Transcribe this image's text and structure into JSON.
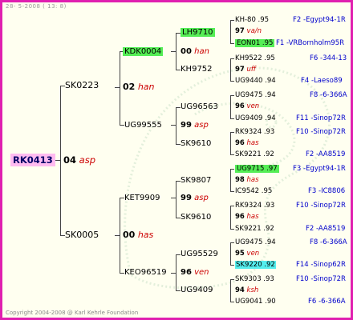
{
  "header": "28- 5-2008 ( 13: 8)",
  "footer": "Copyright 2004-2008 @ Karl Kehrle Foundation",
  "root": {
    "ring": "RK0413",
    "year": "04",
    "note": "asp"
  },
  "gen2": [
    {
      "ring": "SK0223",
      "year": "",
      "note": ""
    },
    {
      "ring": "SK0005",
      "year": "",
      "note": ""
    }
  ],
  "gen2_stats": [
    {
      "year": "02",
      "note": "han"
    },
    {
      "year": "00",
      "note": "has"
    }
  ],
  "gen3": [
    {
      "ring": "KDK0004",
      "year": "",
      "note": ""
    },
    {
      "ring": "UG99555",
      "year": "",
      "note": ""
    },
    {
      "ring": "KET9909",
      "year": "",
      "note": ""
    },
    {
      "ring": "KEO96519",
      "year": "",
      "note": ""
    }
  ],
  "gen3_stats": [
    {
      "year": "",
      "note": ""
    },
    {
      "year": "99",
      "note": "asp"
    },
    {
      "year": "99",
      "note": "asp"
    },
    {
      "year": "96",
      "note": "ven"
    }
  ],
  "gen4": [
    {
      "ring": "LH9710",
      "mid_year": "00",
      "mid_note": "han",
      "ring2": "KH9752"
    },
    {
      "ring": "UG96563",
      "mid_year": "99",
      "mid_note": "asp",
      "ring2": "SK9610"
    },
    {
      "ring": "SK9807",
      "mid_year": "99",
      "mid_note": "asp",
      "ring2": "SK9610"
    },
    {
      "ring": "UG95529",
      "mid_year": "96",
      "mid_note": "ven",
      "ring2": "UG9409"
    }
  ],
  "gen5": [
    {
      "a": "KH-80 .95",
      "mid": "97",
      "mid_note": "va/n",
      "b": "EON01 .95",
      "loc_a": "F2 -Egypt94-1R",
      "loc_b": "F1 -VRBornholm95R"
    },
    {
      "a": "KH9522 .95",
      "mid": "97",
      "mid_note": "uff",
      "b": "UG9440 .94",
      "loc_a": "F6 -344-13",
      "loc_b": "F4 -Laeso89"
    },
    {
      "a": "UG9475 .94",
      "mid": "96",
      "mid_note": "ven",
      "b": "UG9409 .94",
      "loc_a": "F8 -6-366A",
      "loc_b": "F11 -Sinop72R"
    },
    {
      "a": "RK9324 .93",
      "mid": "96",
      "mid_note": "has",
      "b": "SK9221 .92",
      "loc_a": "F10 -Sinop72R",
      "loc_b": "F2 -AA8519"
    },
    {
      "a": "UG9715 .97",
      "mid": "98",
      "mid_note": "has",
      "b": "IC9542 .95",
      "loc_a": "F3 -Egypt94-1R",
      "loc_b": "F3 -IC8806"
    },
    {
      "a": "RK9324 .93",
      "mid": "96",
      "mid_note": "has",
      "b": "SK9221 .92",
      "loc_a": "F10 -Sinop72R",
      "loc_b": "F2 -AA8519"
    },
    {
      "a": "UG9475 .94",
      "mid": "95",
      "mid_note": "ven",
      "b": "SK9220 .92",
      "loc_a": "F8 -6-366A",
      "loc_b": "F14 -Sinop62R"
    },
    {
      "a": "SK9303 .93",
      "mid": "94",
      "mid_note": "ksh",
      "b": "UG9041 .90",
      "loc_a": "F10 -Sinop72R",
      "loc_b": "F6 -6-366A"
    }
  ]
}
